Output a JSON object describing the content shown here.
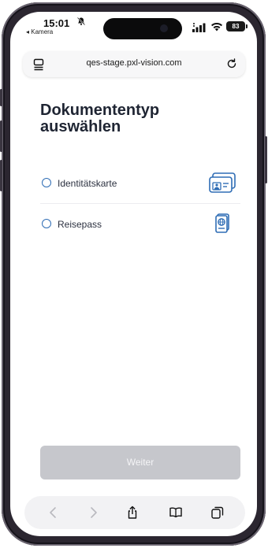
{
  "status_bar": {
    "time": "15:01",
    "back_app": "◂ Kamera",
    "battery": "83"
  },
  "browser": {
    "url": "qes-stage.pxl-vision.com"
  },
  "page": {
    "title": "Dokumententyp auswählen",
    "options": [
      {
        "label": "Identitätskarte",
        "icon": "id-card-icon",
        "selected": false
      },
      {
        "label": "Reisepass",
        "icon": "passport-icon",
        "selected": false
      }
    ],
    "continue_label": "Weiter",
    "continue_enabled": false
  },
  "colors": {
    "accent": "#2f6db5",
    "title": "#1f2533",
    "button_disabled": "#c6c7cc"
  }
}
